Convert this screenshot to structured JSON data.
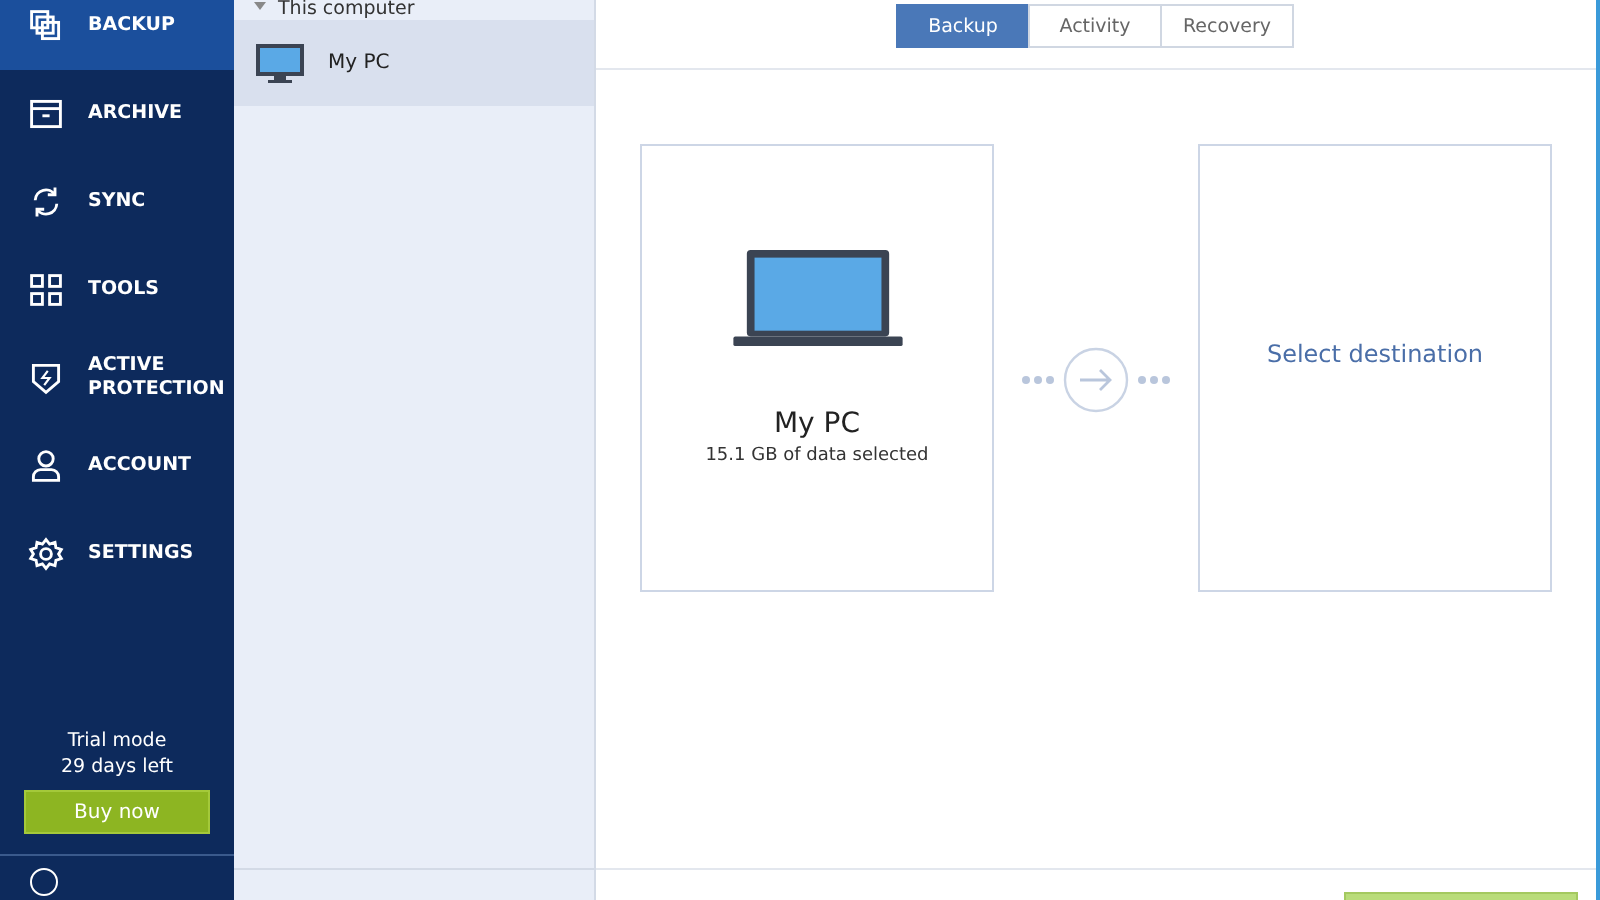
{
  "nav": {
    "items": [
      {
        "label": "BACKUP",
        "selected": true
      },
      {
        "label": "ARCHIVE",
        "selected": false
      },
      {
        "label": "SYNC",
        "selected": false
      },
      {
        "label": "TOOLS",
        "selected": false
      },
      {
        "label": "ACTIVE PROTECTION",
        "selected": false
      },
      {
        "label": "ACCOUNT",
        "selected": false
      },
      {
        "label": "SETTINGS",
        "selected": false
      }
    ],
    "trial": [
      "Trial mode",
      "29 days left"
    ],
    "buy_button": "Buy now"
  },
  "backup_list": {
    "group": "This computer",
    "items": [
      {
        "label": "My PC",
        "selected": true
      }
    ]
  },
  "tabs": [
    {
      "label": "Backup",
      "selected": true
    },
    {
      "label": "Activity",
      "selected": false
    },
    {
      "label": "Recovery",
      "selected": false
    }
  ],
  "source": {
    "title": "My PC",
    "subtitle": "15.1 GB of data selected"
  },
  "destination": {
    "label": "Select destination"
  }
}
